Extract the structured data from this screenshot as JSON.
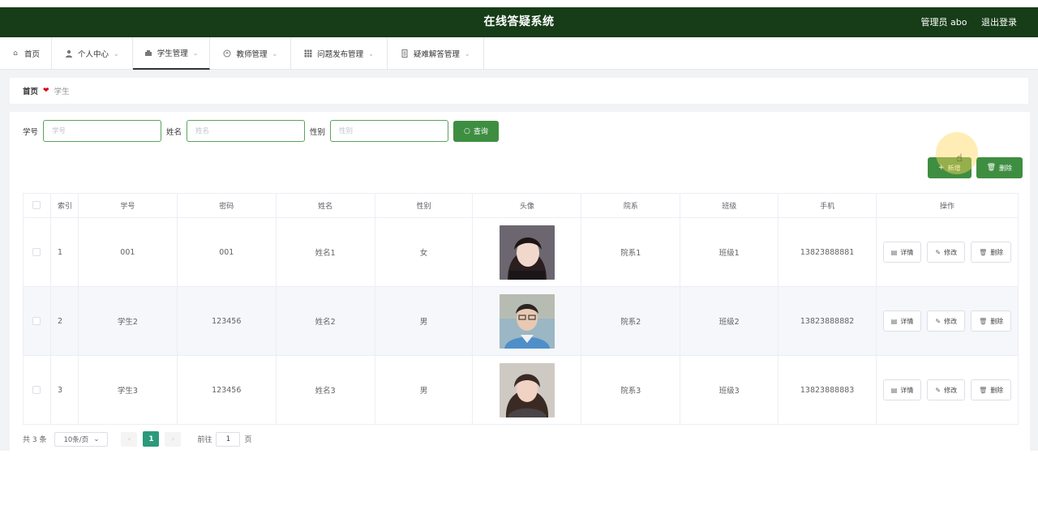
{
  "header": {
    "title": "在线答疑系统",
    "user_label": "管理员 abo",
    "logout_label": "退出登录"
  },
  "nav": {
    "items": [
      {
        "label": "首页",
        "icon": "home-icon"
      },
      {
        "label": "个人中心",
        "icon": "user-icon"
      },
      {
        "label": "学生管理",
        "icon": "student-icon"
      },
      {
        "label": "教师管理",
        "icon": "teacher-icon"
      },
      {
        "label": "问题发布管理",
        "icon": "grid-icon"
      },
      {
        "label": "疑难解答管理",
        "icon": "doc-icon"
      }
    ]
  },
  "breadcrumb": {
    "home": "首页",
    "current": "学生"
  },
  "search": {
    "xuehao_label": "学号",
    "xuehao_placeholder": "学号",
    "name_label": "姓名",
    "name_placeholder": "姓名",
    "gender_label": "性别",
    "gender_placeholder": "性别",
    "query_label": "查询"
  },
  "actions": {
    "add_label": "新增",
    "delete_label": "删除"
  },
  "table": {
    "headers": [
      "索引",
      "学号",
      "密码",
      "姓名",
      "性别",
      "头像",
      "院系",
      "班级",
      "手机",
      "操作"
    ],
    "rows": [
      {
        "index": "1",
        "xuehao": "001",
        "password": "001",
        "name": "姓名1",
        "gender": "女",
        "dept": "院系1",
        "class": "班级1",
        "phone": "13823888881"
      },
      {
        "index": "2",
        "xuehao": "学生2",
        "password": "123456",
        "name": "姓名2",
        "gender": "男",
        "dept": "院系2",
        "class": "班级2",
        "phone": "13823888882"
      },
      {
        "index": "3",
        "xuehao": "学生3",
        "password": "123456",
        "name": "姓名3",
        "gender": "男",
        "dept": "院系3",
        "class": "班级3",
        "phone": "13823888883"
      }
    ],
    "row_actions": {
      "detail": "详情",
      "edit": "修改",
      "delete": "删除"
    }
  },
  "pagination": {
    "total": "共 3 条",
    "page_size": "10条/页",
    "current_page": "1",
    "goto_label": "前往",
    "goto_value": "1",
    "page_suffix": "页"
  },
  "colors": {
    "header_bg": "#163d17",
    "primary_green": "#3e8e41",
    "page_active": "#2a9a7b"
  }
}
